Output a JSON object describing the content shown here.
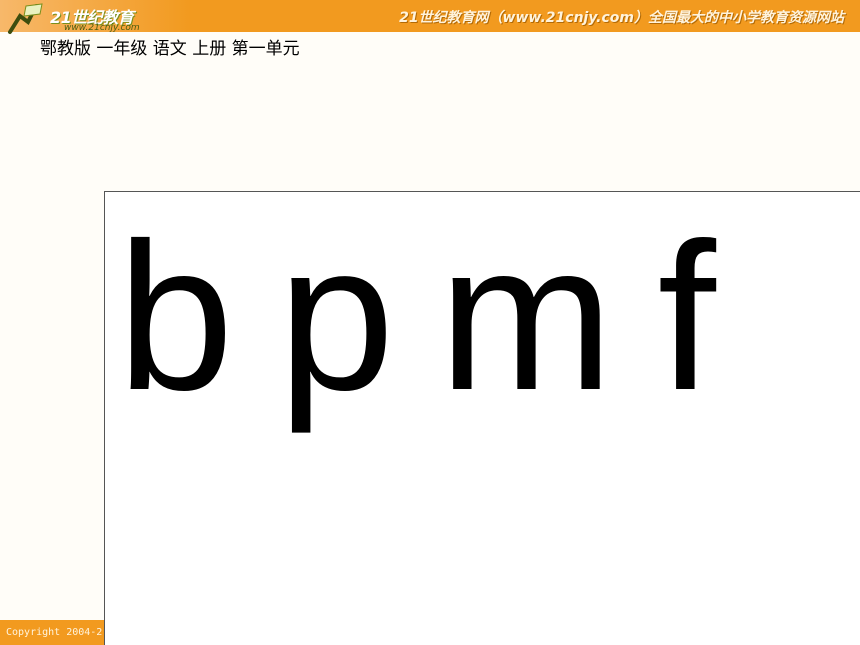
{
  "header": {
    "logo_text": "21世纪教育",
    "logo_sub": "www.21cnjy.com",
    "site_line": "21世纪教育网（www.21cnjy.com）全国最大的中小学教育资源网站"
  },
  "subtitle": "鄂教版 一年级 语文 上册 第一单元",
  "content": {
    "letters": [
      "b",
      "p",
      "m",
      "f"
    ]
  },
  "footer": {
    "copyright": "Copyright 2004-2"
  },
  "colors": {
    "banner": "#f29a1f",
    "background": "#fffdf8",
    "box": "#ffffff"
  }
}
